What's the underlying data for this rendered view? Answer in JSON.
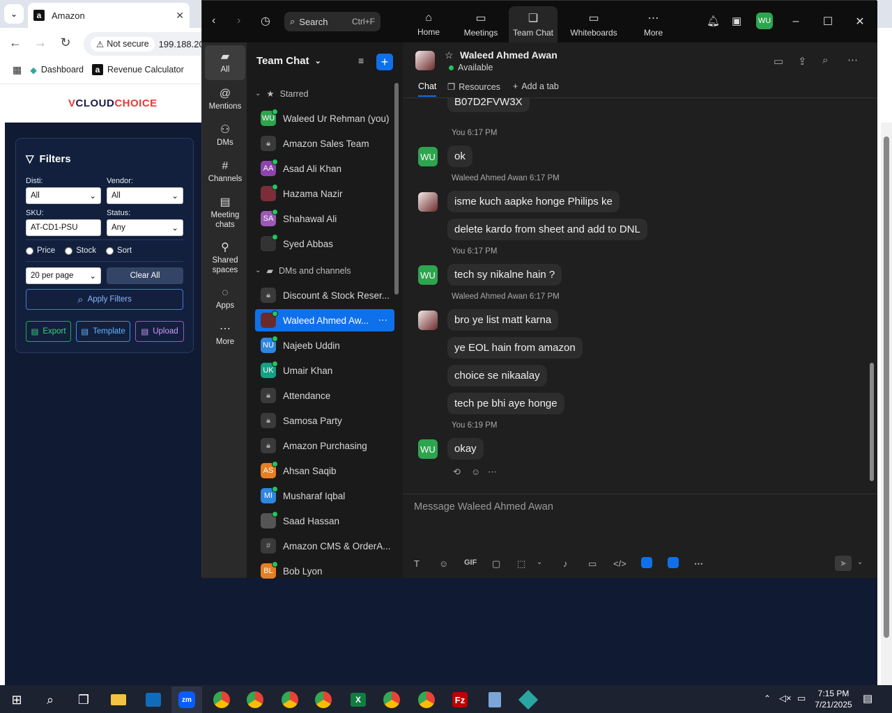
{
  "browser": {
    "tab_title": "Amazon",
    "address_security": "Not secure",
    "address_host": "199.188.20",
    "bookmarks": [
      "Dashboard",
      "Revenue Calculator"
    ]
  },
  "site": {
    "logo_text": "VCLOUDCHOICE",
    "filters_title": "Filters",
    "disti_label": "Disti:",
    "disti_value": "All",
    "vendor_label": "Vendor:",
    "vendor_value": "All",
    "sku_label": "SKU:",
    "sku_value": "AT-CD1-PSU",
    "status_label": "Status:",
    "status_value": "Any",
    "radio_price": "Price",
    "radio_stock": "Stock",
    "radio_sort": "Sort",
    "per_page": "20 per page",
    "clear_all": "Clear All",
    "apply_filters": "Apply Filters",
    "export": "Export",
    "template": "Template",
    "upload": "Upload"
  },
  "zoom": {
    "search_label": "Search",
    "search_shortcut": "Ctrl+F",
    "tabs": [
      "Home",
      "Meetings",
      "Team Chat",
      "Whiteboards",
      "More"
    ],
    "user_initials": "WU",
    "rail": [
      "All",
      "Mentions",
      "DMs",
      "Channels",
      "Meeting chats",
      "Shared spaces",
      "Apps",
      "More"
    ],
    "list_title": "Team Chat",
    "section_starred": "Starred",
    "section_dms": "DMs and channels",
    "starred": [
      {
        "name": "Waleed Ur Rehman (you)",
        "initials": "WU",
        "color": "#2ea44f"
      },
      {
        "name": "Amazon Sales Team",
        "initials": "",
        "color": "lock"
      },
      {
        "name": "Asad Ali Khan",
        "initials": "AA",
        "color": "#8e44ad"
      },
      {
        "name": "Hazama Nazir",
        "initials": "",
        "color": "#7b2d3a"
      },
      {
        "name": "Shahawal Ali",
        "initials": "SA",
        "color": "#9b59b6"
      },
      {
        "name": "Syed Abbas",
        "initials": "",
        "color": "#333"
      }
    ],
    "dms": [
      {
        "name": "Discount & Stock Reser...",
        "initials": "",
        "color": "lock"
      },
      {
        "name": "Waleed Ahmed Aw...",
        "initials": "",
        "color": "#6b2b2b"
      },
      {
        "name": "Najeeb Uddin",
        "initials": "NU",
        "color": "#2e86de"
      },
      {
        "name": "Umair Khan",
        "initials": "UK",
        "color": "#16a085"
      },
      {
        "name": "Attendance",
        "initials": "",
        "color": "lock"
      },
      {
        "name": "Samosa Party",
        "initials": "",
        "color": "lock"
      },
      {
        "name": "Amazon Purchasing",
        "initials": "",
        "color": "lock"
      },
      {
        "name": "Ahsan Saqib",
        "initials": "AS",
        "color": "#e67e22"
      },
      {
        "name": "Musharaf Iqbal",
        "initials": "MI",
        "color": "#2e86de"
      },
      {
        "name": "Saad Hassan",
        "initials": "",
        "color": "#555"
      },
      {
        "name": "Amazon CMS & OrderA...",
        "initials": "#",
        "color": "hash"
      },
      {
        "name": "Bob Lyon",
        "initials": "BL",
        "color": "#e67e22"
      }
    ],
    "chat": {
      "contact_name": "Waleed Ahmed Awan",
      "contact_status": "Available",
      "tab_chat": "Chat",
      "tab_resources": "Resources",
      "tab_add": "Add a tab",
      "partial_text": "B07D2FVW3X",
      "messages": [
        {
          "meta": "You 6:17 PM",
          "lines": [
            "ok"
          ]
        },
        {
          "meta": "Waleed Ahmed Awan 6:17 PM",
          "lines": [
            "isme kuch aapke honge Philips ke",
            "delete kardo from sheet and add to DNL"
          ]
        },
        {
          "meta": "You 6:17 PM",
          "lines": [
            "tech sy nikalne hain ?"
          ]
        },
        {
          "meta": "Waleed Ahmed Awan 6:17 PM",
          "lines": [
            "bro ye list matt karna",
            "ye EOL hain from amazon",
            "choice se nikaalay",
            "tech pe bhi aye honge"
          ]
        },
        {
          "meta": "You 6:19 PM",
          "lines": [
            "okay"
          ]
        }
      ],
      "composer_placeholder": "Message Waleed Ahmed Awan"
    }
  },
  "taskbar": {
    "time": "7:15 PM",
    "date": "7/21/2025"
  }
}
